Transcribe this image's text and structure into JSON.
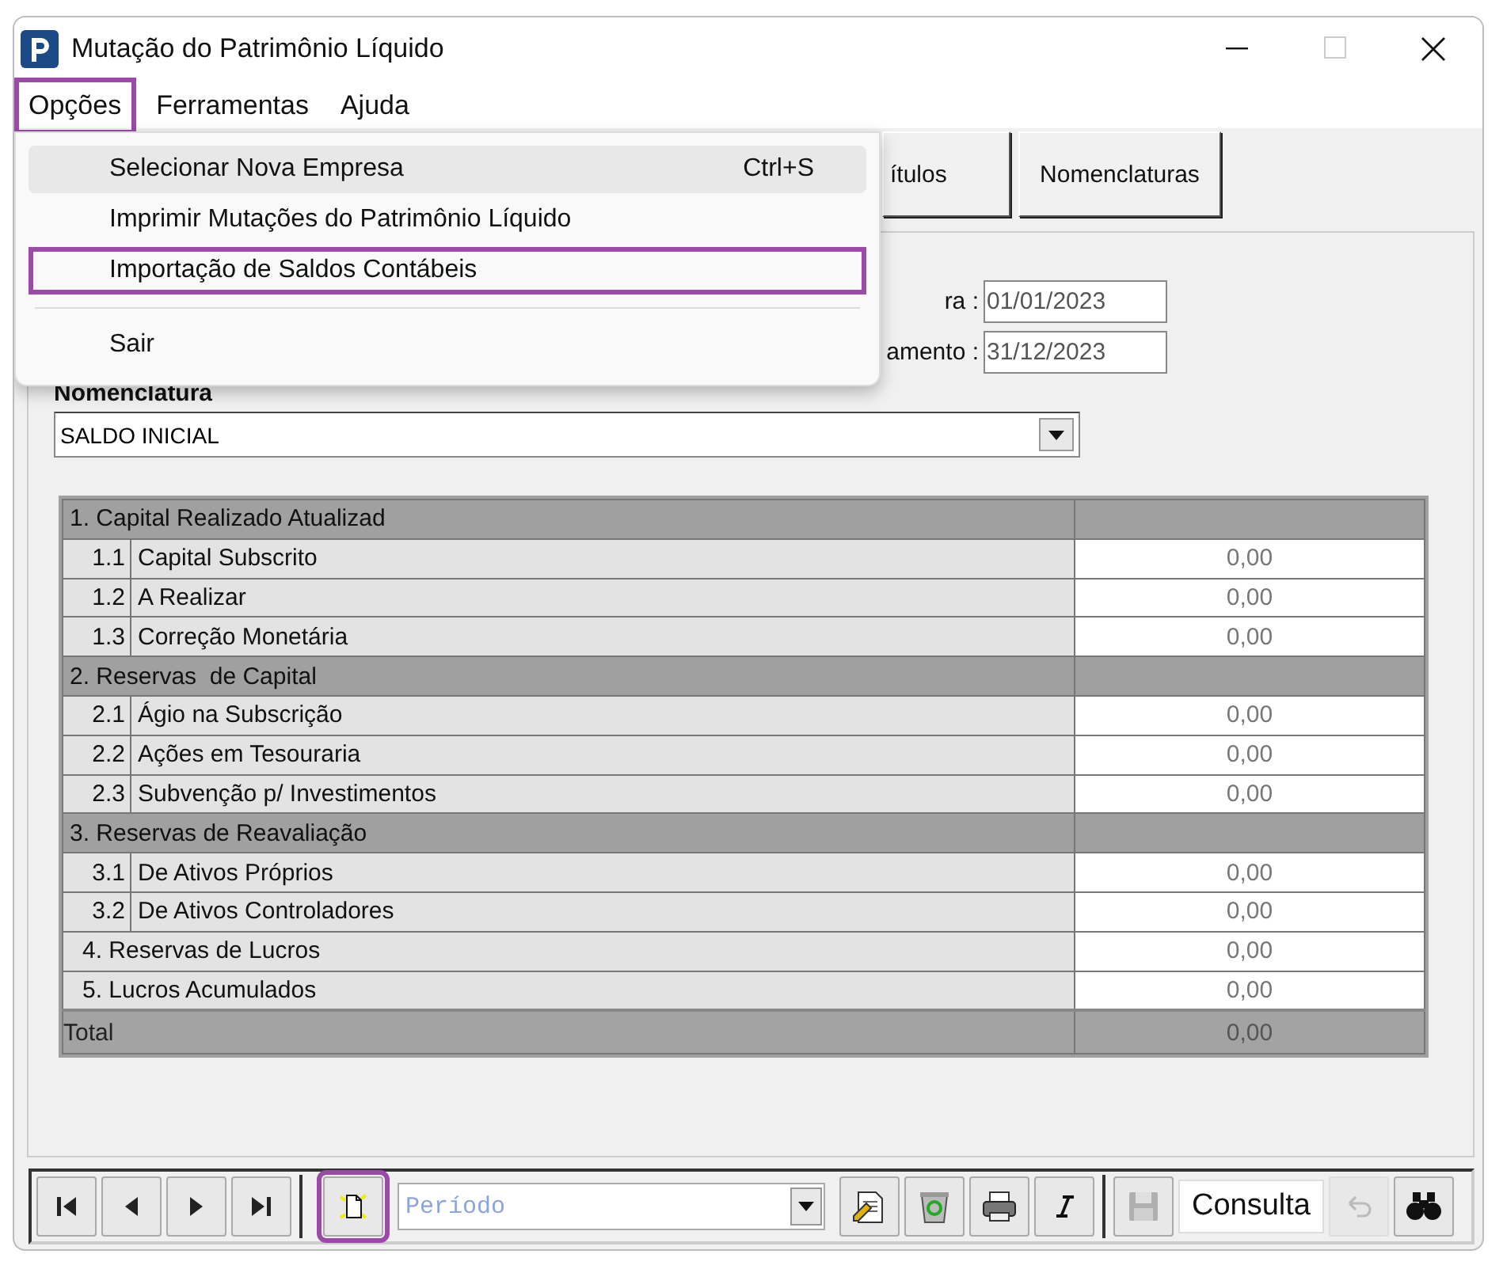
{
  "window": {
    "title": "Mutação do Patrimônio Líquido",
    "maximize_disabled": true
  },
  "menubar": [
    {
      "label": "Opções",
      "marked": true
    },
    {
      "label": "Ferramentas",
      "marked": false
    },
    {
      "label": "Ajuda",
      "marked": false
    }
  ],
  "dropdown": [
    {
      "kind": "item",
      "label": "Selecionar Nova Empresa",
      "shortcut": "Ctrl+S",
      "hovered": true,
      "marked": false
    },
    {
      "kind": "item",
      "label": "Imprimir Mutações do Patrimônio Líquido",
      "hovered": false,
      "marked": false
    },
    {
      "kind": "item",
      "label": "Importação de Saldos Contábeis",
      "hovered": false,
      "marked": true
    },
    {
      "kind": "separator"
    },
    {
      "kind": "item",
      "label": "Sair",
      "hovered": false,
      "marked": false
    }
  ],
  "top_buttons": [
    {
      "label": "ítulos"
    },
    {
      "label": "Nomenclaturas"
    }
  ],
  "dates": [
    {
      "label": "ra :",
      "value": "01/01/2023"
    },
    {
      "label": "amento :",
      "value": "31/12/2023"
    }
  ],
  "nomenclatura": {
    "label": "Nomenclatura",
    "value": "SALDO INICIAL"
  },
  "table": {
    "rows": [
      {
        "kind": "section",
        "label": "1. Capital Realizado Atualizad"
      },
      {
        "kind": "item",
        "number": "1.1",
        "label": "Capital Subscrito",
        "value": "0,00"
      },
      {
        "kind": "item",
        "number": "1.2",
        "label": "A Realizar",
        "value": "0,00"
      },
      {
        "kind": "item",
        "number": "1.3",
        "label": "Correção Monetária",
        "value": "0,00"
      },
      {
        "kind": "section",
        "label": "2. Reservas  de Capital"
      },
      {
        "kind": "item",
        "number": "2.1",
        "label": "Ágio na Subscrição",
        "value": "0,00"
      },
      {
        "kind": "item",
        "number": "2.2",
        "label": "Ações em Tesouraria",
        "value": "0,00"
      },
      {
        "kind": "item",
        "number": "2.3",
        "label": "Subvenção p/ Investimentos",
        "value": "0,00"
      },
      {
        "kind": "section",
        "label": "3. Reservas de Reavaliação"
      },
      {
        "kind": "item",
        "number": "3.1",
        "label": "De Ativos Próprios",
        "value": "0,00"
      },
      {
        "kind": "item",
        "number": "3.2",
        "label": "De Ativos Controladores",
        "value": "0,00"
      },
      {
        "kind": "plain",
        "label": "4. Reservas de Lucros",
        "value": "0,00"
      },
      {
        "kind": "plain",
        "label": "5. Lucros Acumulados",
        "value": "0,00"
      },
      {
        "kind": "total",
        "label": "Total",
        "value": "0,00"
      }
    ]
  },
  "toolbar": {
    "new_marked": true,
    "period": {
      "placeholder": "Período"
    },
    "save_disabled": true,
    "mode": "Consulta",
    "undo_disabled": true
  }
}
